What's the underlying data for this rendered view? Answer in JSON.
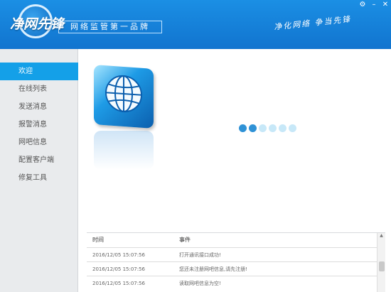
{
  "header": {
    "logo_text": "净网先锋",
    "slogan": "网络监管第一品牌",
    "tagline": "净化网络 争当先锋",
    "controls": {
      "settings": "⚙",
      "minimize": "–",
      "close": "✕"
    }
  },
  "sidebar": {
    "items": [
      {
        "label": "欢迎",
        "active": true
      },
      {
        "label": "在线列表",
        "active": false
      },
      {
        "label": "发送消息",
        "active": false
      },
      {
        "label": "报警消息",
        "active": false
      },
      {
        "label": "网吧信息",
        "active": false
      },
      {
        "label": "配置客户端",
        "active": false
      },
      {
        "label": "修复工具",
        "active": false
      }
    ]
  },
  "loading": {
    "dots": [
      {
        "state": "active"
      },
      {
        "state": "active"
      },
      {
        "state": "idle"
      },
      {
        "state": "idle"
      },
      {
        "state": "idle"
      },
      {
        "state": "idle"
      }
    ]
  },
  "colors": {
    "header": "#1581d8",
    "nav_active": "#14a0e8",
    "dot_active": "#2f92d6",
    "dot_idle": "#c7e8f8"
  },
  "log": {
    "headers": {
      "time": "时间",
      "event": "事件"
    },
    "rows": [
      {
        "time": "2016/12/05 15:07:56",
        "event": "打开通讯接口成功!"
      },
      {
        "time": "2016/12/05 15:07:56",
        "event": "您还未注册网吧信息,请先注册!"
      },
      {
        "time": "2016/12/05 15:07:56",
        "event": "读取网吧信息为空!"
      }
    ]
  }
}
